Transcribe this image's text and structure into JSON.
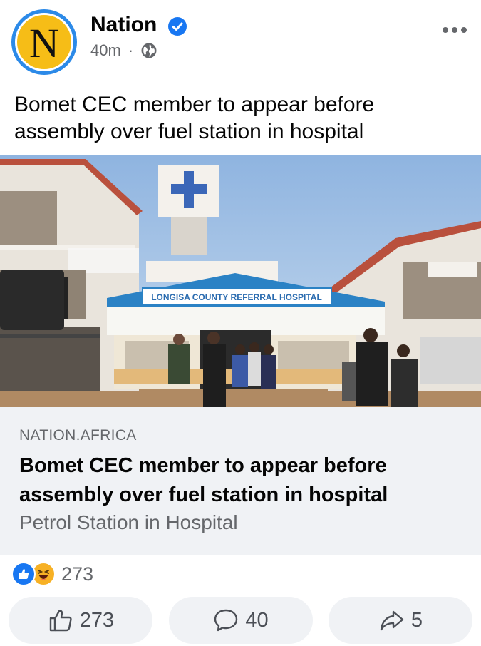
{
  "post": {
    "page_name": "Nation",
    "avatar_letter": "N",
    "time": "40m",
    "separator": "·",
    "text": "Bomet CEC member to appear before assembly over fuel station in hospital"
  },
  "photo": {
    "sign_text": "LONGISA COUNTY REFERRAL HOSPITAL"
  },
  "link_preview": {
    "domain": "NATION.AFRICA",
    "title": "Bomet CEC member to appear before assembly over fuel station in hospital",
    "subtitle": "Petrol Station in Hospital"
  },
  "reactions": {
    "icons": [
      "like-icon",
      "haha-icon"
    ],
    "count": "273"
  },
  "actions": {
    "like_count": "273",
    "comment_count": "40",
    "share_count": "5"
  },
  "colors": {
    "brand_blue": "#1877f2",
    "avatar_yellow": "#f6bd17",
    "secondary_text": "#65676b",
    "card_background": "#f0f2f5"
  }
}
